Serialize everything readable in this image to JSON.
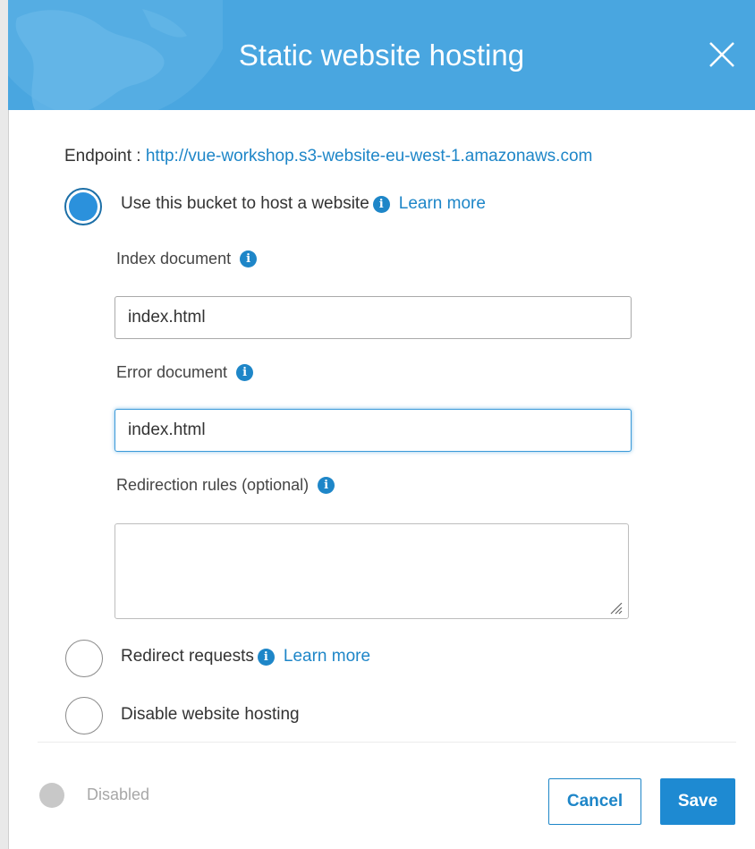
{
  "modal": {
    "title": "Static website hosting",
    "colors": {
      "header": "#49a6e0",
      "link": "#1e86c8",
      "accent": "#2b91dc"
    }
  },
  "endpoint": {
    "label": "Endpoint :",
    "url": "http://vue-workshop.s3-website-eu-west-1.amazonaws.com"
  },
  "options": {
    "host": {
      "label": "Use this bucket to host a website",
      "learn_more": "Learn more",
      "selected": true
    },
    "redirect": {
      "label": "Redirect requests",
      "learn_more": "Learn more",
      "selected": false
    },
    "disable": {
      "label": "Disable website hosting",
      "selected": false
    }
  },
  "fields": {
    "index": {
      "label": "Index document",
      "value": "index.html"
    },
    "error": {
      "label": "Error document",
      "value": "index.html"
    },
    "redirection": {
      "label": "Redirection rules (optional)",
      "value": ""
    }
  },
  "icons": {
    "info": "i",
    "close": "close-icon"
  },
  "footer": {
    "status": "Disabled",
    "cancel": "Cancel",
    "save": "Save"
  }
}
